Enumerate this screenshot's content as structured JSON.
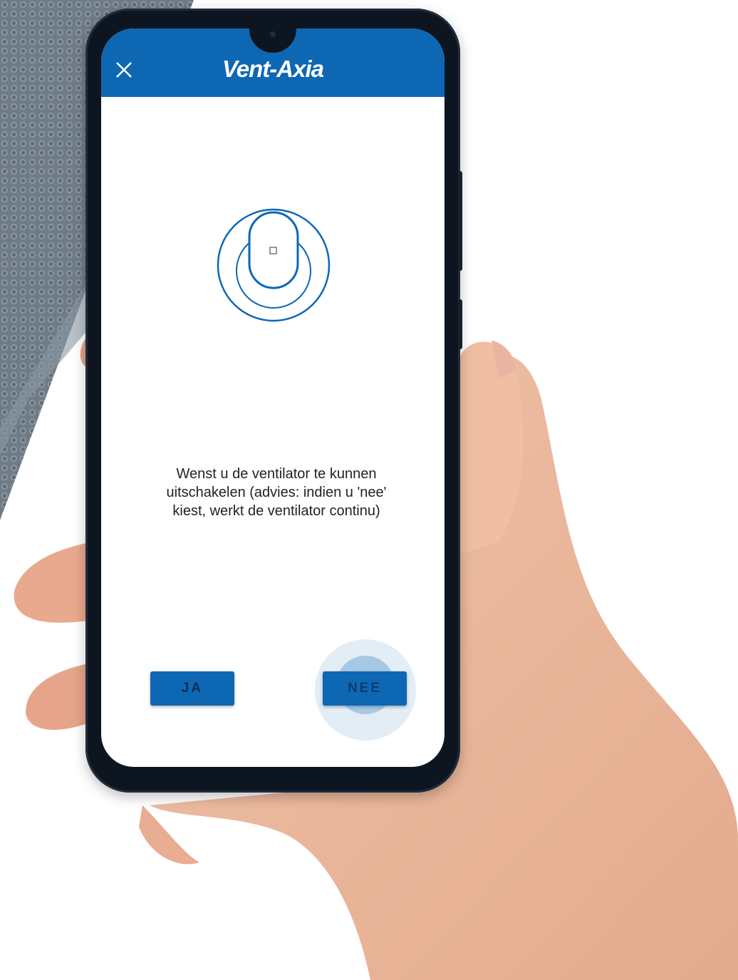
{
  "app": {
    "brand": "Vent-Axia",
    "close_icon": "close-icon",
    "accent_color": "#0e67b3"
  },
  "main": {
    "device_icon": "fan-device-icon",
    "question": "Wenst u de ventilator te kunnen uitschakelen (advies: indien u 'nee' kiest, werkt de ventilator continu)"
  },
  "actions": {
    "yes_label": "JA",
    "no_label": "NEE"
  }
}
